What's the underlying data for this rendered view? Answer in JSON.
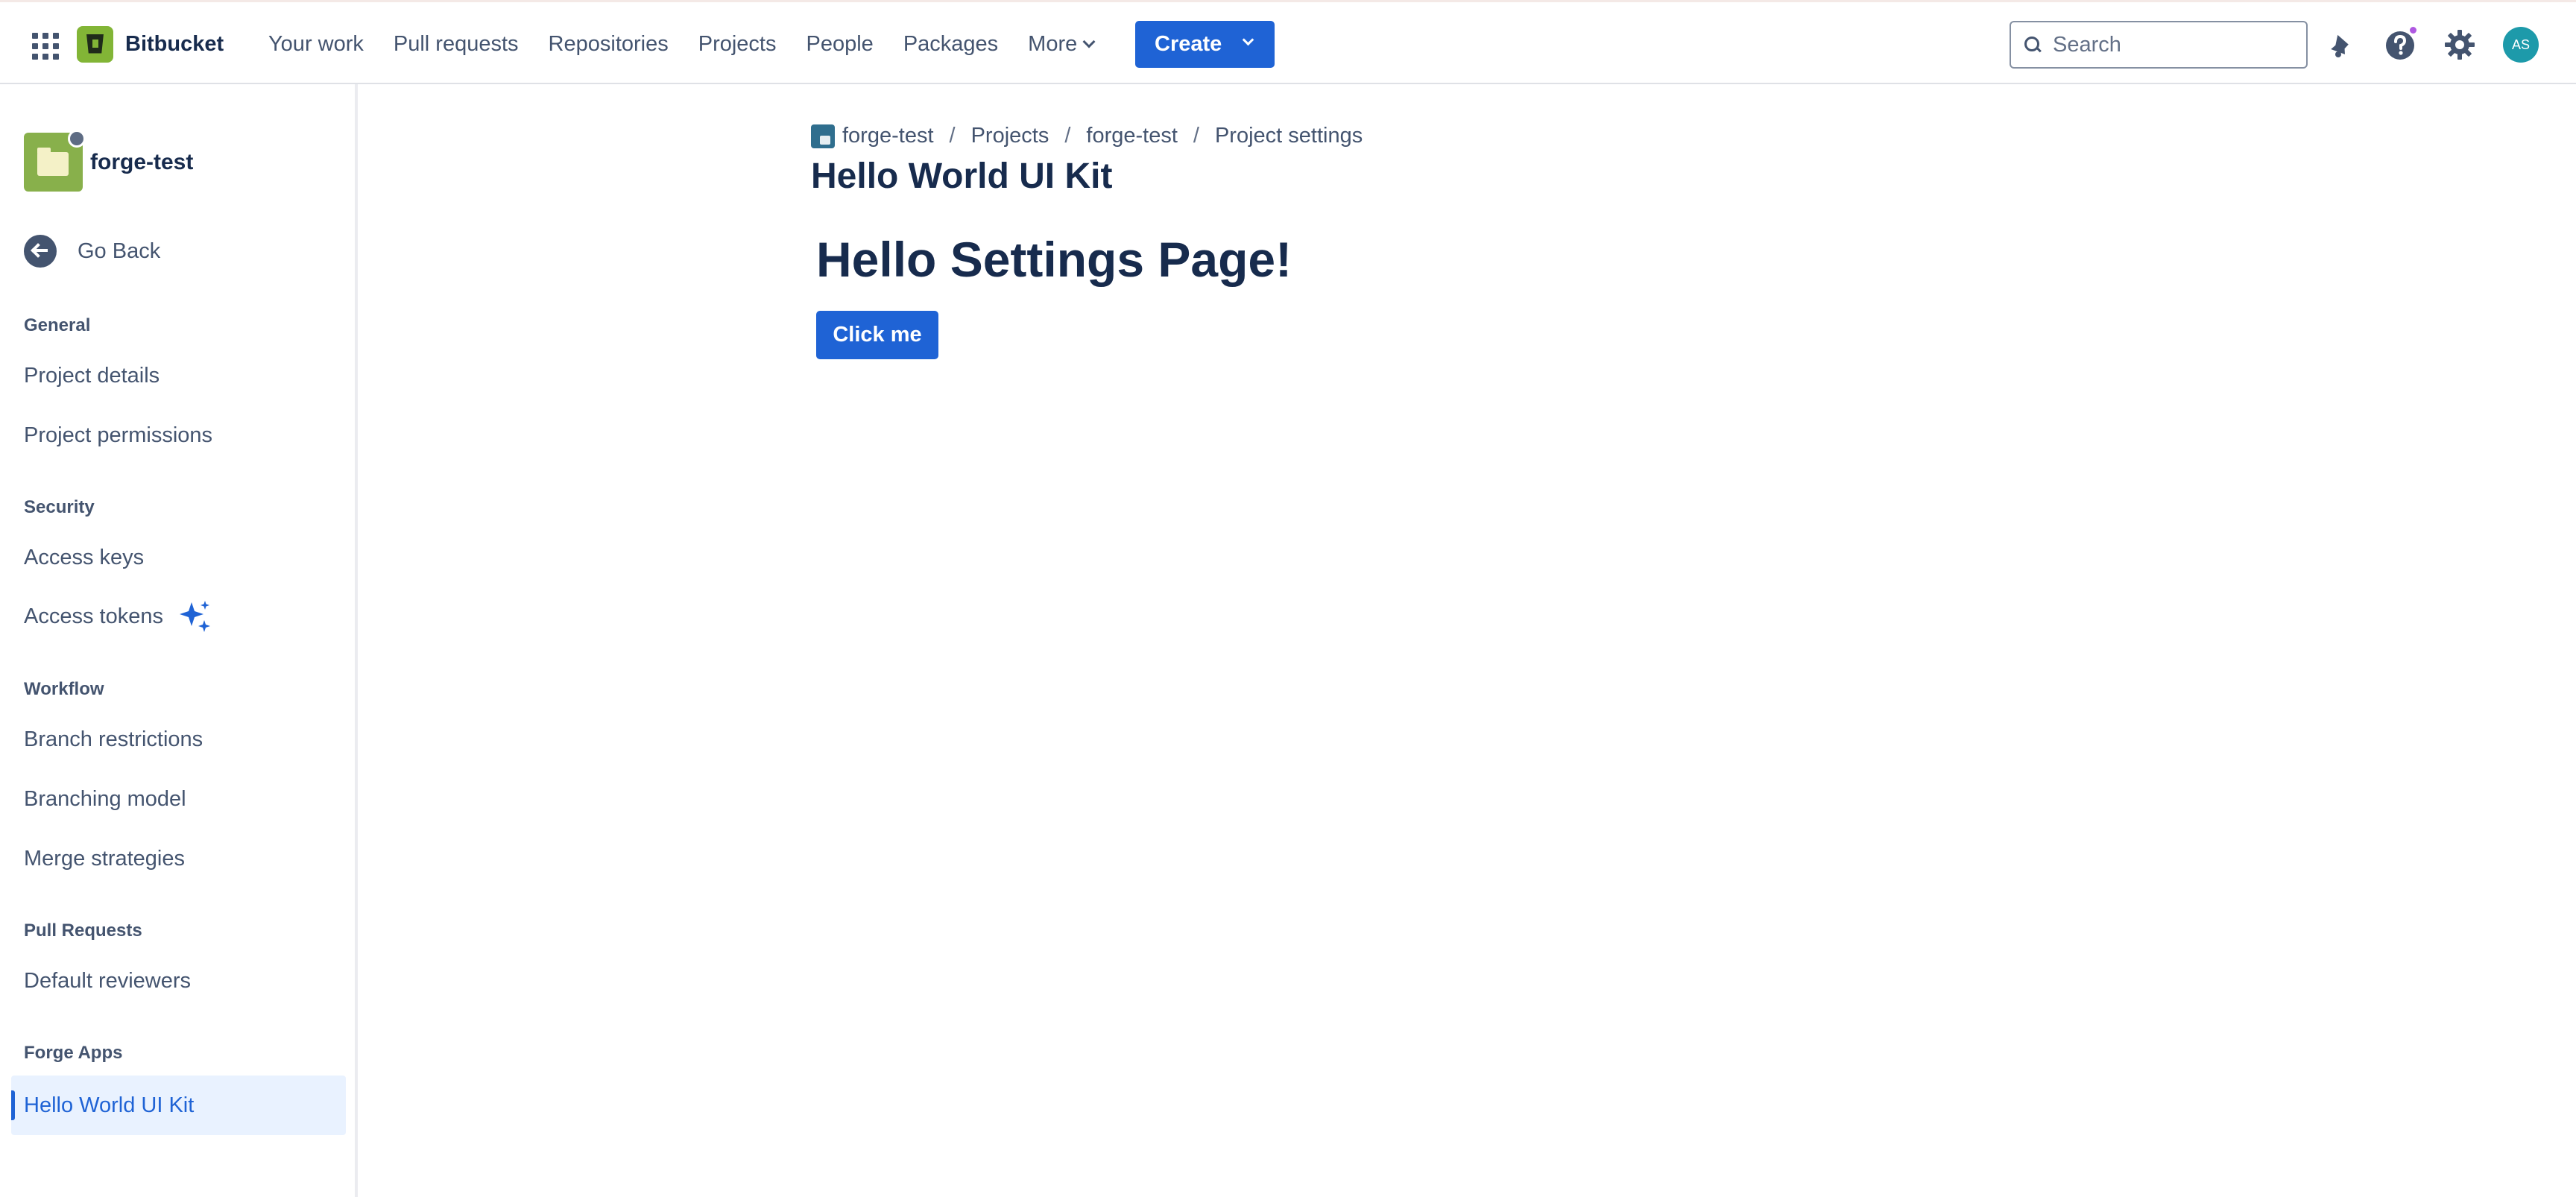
{
  "topbar": {
    "brand": "Bitbucket",
    "nav": [
      "Your work",
      "Pull requests",
      "Repositories",
      "Projects",
      "People",
      "Packages"
    ],
    "more_label": "More",
    "create_label": "Create",
    "search_placeholder": "Search",
    "avatar_initials": "AS"
  },
  "sidebar": {
    "project_name": "forge-test",
    "go_back": "Go Back",
    "sections": {
      "general": "General",
      "security": "Security",
      "workflow": "Workflow",
      "pull_requests": "Pull Requests",
      "forge_apps": "Forge Apps"
    },
    "items": {
      "project_details": "Project details",
      "project_permissions": "Project permissions",
      "access_keys": "Access keys",
      "access_tokens": "Access tokens",
      "branch_restrictions": "Branch restrictions",
      "branching_model": "Branching model",
      "merge_strategies": "Merge strategies",
      "default_reviewers": "Default reviewers",
      "hello_world": "Hello World UI Kit"
    }
  },
  "breadcrumb": [
    "forge-test",
    "Projects",
    "forge-test",
    "Project settings"
  ],
  "main": {
    "title": "Hello World UI Kit",
    "heading": "Hello Settings Page!",
    "button": "Click me"
  },
  "colors": {
    "primary": "#1f63d5",
    "active_bg": "#e9f2ff",
    "text": "#172b4d",
    "subtle_text": "#44546f",
    "notification": "#af59e1"
  }
}
